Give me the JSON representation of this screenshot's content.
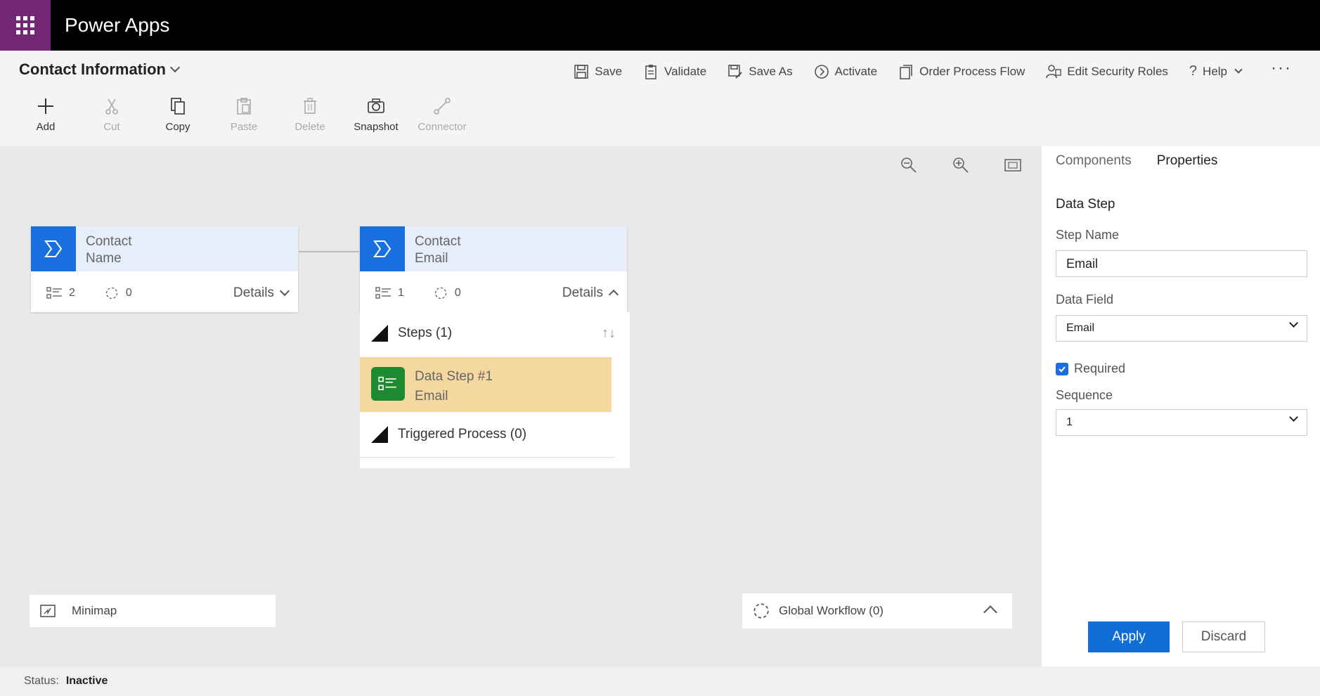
{
  "app": {
    "title": "Power Apps"
  },
  "process": {
    "title": "Contact Information"
  },
  "top_commands": [
    {
      "label": "Save",
      "icon": "save-icon"
    },
    {
      "label": "Validate",
      "icon": "clipboard-icon"
    },
    {
      "label": "Save As",
      "icon": "save-as-icon"
    },
    {
      "label": "Activate",
      "icon": "activate-icon"
    },
    {
      "label": "Order Process Flow",
      "icon": "order-icon"
    },
    {
      "label": "Edit Security Roles",
      "icon": "security-roles-icon"
    },
    {
      "label": "Help",
      "icon": "help-icon"
    }
  ],
  "ribbon": [
    {
      "label": "Add",
      "icon": "plus-icon",
      "enabled": true
    },
    {
      "label": "Cut",
      "icon": "scissors-icon",
      "enabled": false
    },
    {
      "label": "Copy",
      "icon": "copy-icon",
      "enabled": true
    },
    {
      "label": "Paste",
      "icon": "paste-icon",
      "enabled": false
    },
    {
      "label": "Delete",
      "icon": "trash-icon",
      "enabled": false
    },
    {
      "label": "Snapshot",
      "icon": "camera-icon",
      "enabled": true
    },
    {
      "label": "Connector",
      "icon": "connector-icon",
      "enabled": false
    }
  ],
  "stages": [
    {
      "line1": "Contact",
      "line2": "Name",
      "steps_count": "2",
      "workflows_count": "0",
      "details_label": "Details",
      "expanded": false
    },
    {
      "line1": "Contact",
      "line2": "Email",
      "steps_count": "1",
      "workflows_count": "0",
      "details_label": "Details",
      "expanded": true
    }
  ],
  "expanded_stage": {
    "steps_header": "Steps (1)",
    "sort_glyph": "↑↓",
    "data_step": {
      "title": "Data Step #1",
      "subtitle": "Email"
    },
    "triggered_header": "Triggered Process (0)"
  },
  "minimap": {
    "label": "Minimap"
  },
  "global_workflow": {
    "label": "Global Workflow (0)"
  },
  "properties_panel": {
    "tabs": [
      "Components",
      "Properties"
    ],
    "active_tab": "Properties",
    "heading": "Data Step",
    "step_name_label": "Step Name",
    "step_name_value": "Email",
    "data_field_label": "Data Field",
    "data_field_value": "Email",
    "required_label": "Required",
    "required_checked": true,
    "sequence_label": "Sequence",
    "sequence_value": "1",
    "apply_label": "Apply",
    "discard_label": "Discard"
  },
  "status": {
    "label": "Status:",
    "value": "Inactive"
  },
  "colors": {
    "brand": "#742774",
    "accent": "#0f6fd6",
    "stage_icon": "#1a6fe0",
    "data_step_bg": "#f5d8a0",
    "data_step_icon": "#1e8a2f"
  }
}
